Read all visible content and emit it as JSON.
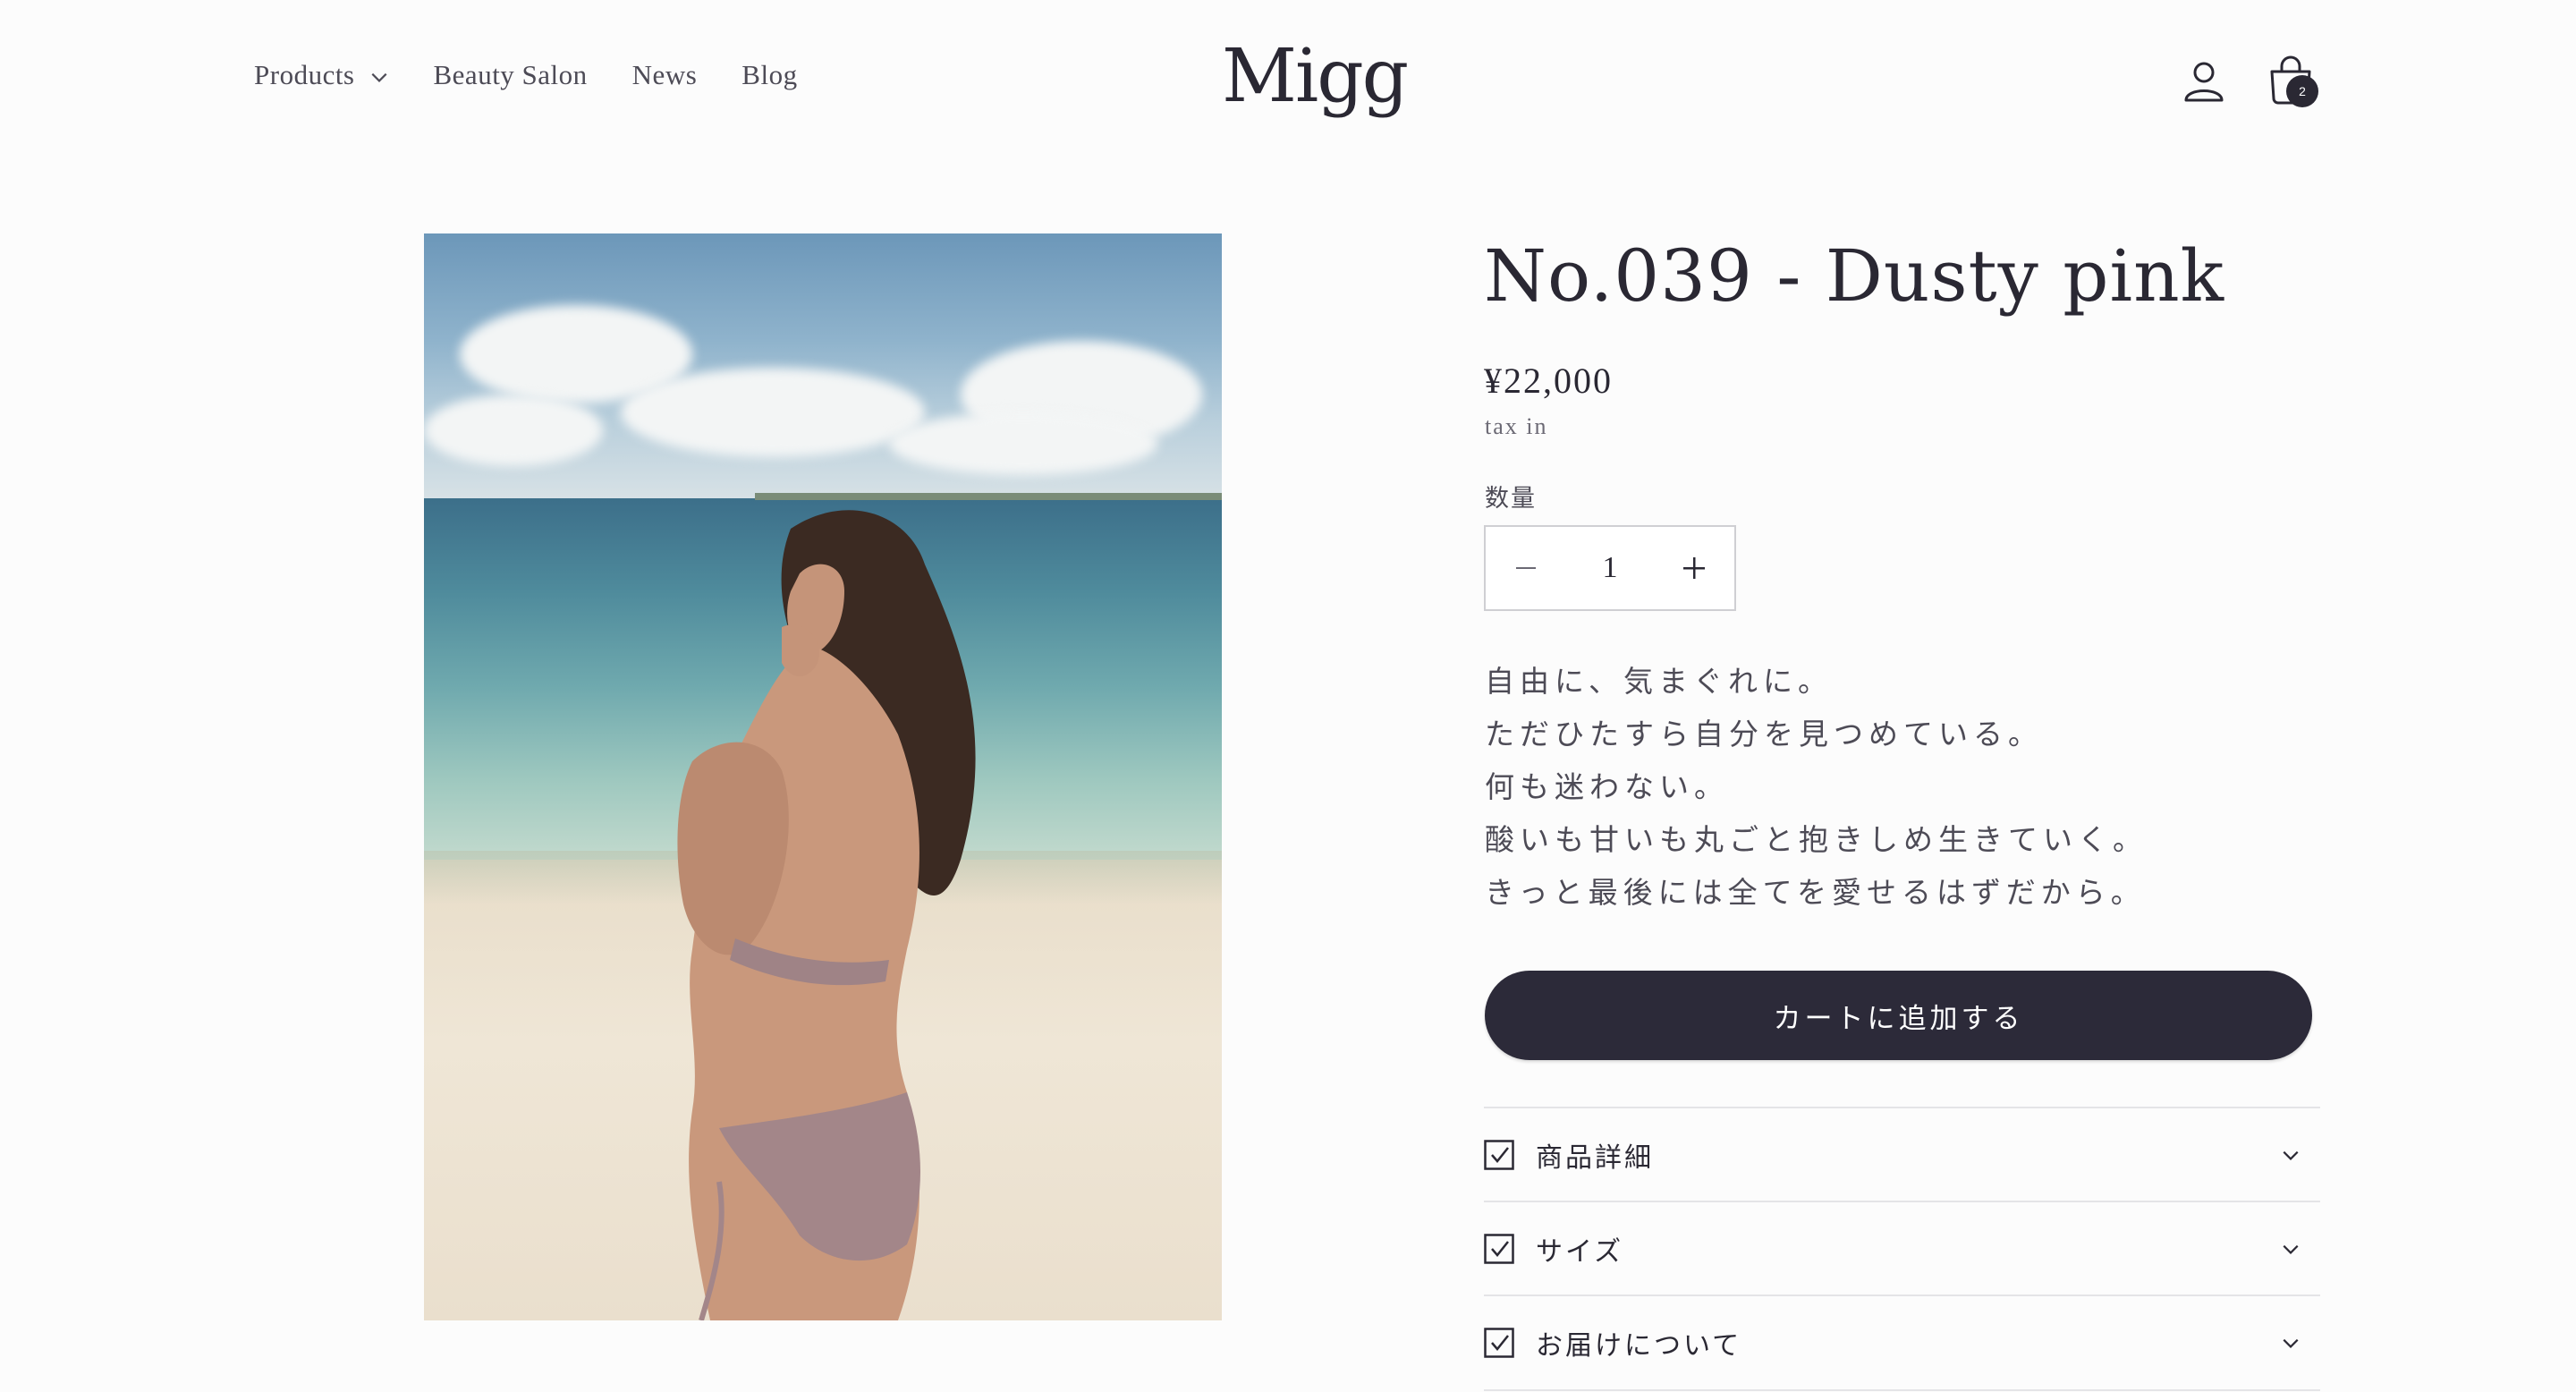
{
  "header": {
    "nav": [
      {
        "label": "Products",
        "has_dropdown": true
      },
      {
        "label": "Beauty Salon"
      },
      {
        "label": "News"
      },
      {
        "label": "Blog"
      }
    ],
    "logo": "Migg",
    "cart_count": "2",
    "icons": {
      "account": "account-icon",
      "cart": "cart-icon"
    }
  },
  "product": {
    "title": "No.039 - Dusty pink",
    "price": "¥22,000",
    "tax_note": "tax in",
    "quantity_label": "数量",
    "quantity": "1",
    "description": [
      "自由に、気まぐれに。",
      "ただひたすら自分を見つめている。",
      "何も迷わない。",
      "酸いも甘いも丸ごと抱きしめ生きていく。",
      "きっと最後には全てを愛せるはずだから。"
    ],
    "add_to_cart": "カートに追加する",
    "accordions": [
      {
        "label": "商品詳細"
      },
      {
        "label": "サイズ"
      },
      {
        "label": "お届けについて"
      }
    ]
  },
  "colors": {
    "primary": "#2c2a39",
    "background": "#fcfcfc",
    "border": "#e4e4e7"
  }
}
